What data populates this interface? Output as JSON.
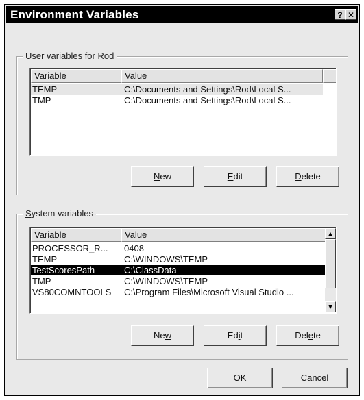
{
  "title": "Environment Variables",
  "titlebar_buttons": {
    "help": "?",
    "close": "✕"
  },
  "user_group": {
    "legend_first": "U",
    "legend_rest": "ser variables for Rod",
    "columns": [
      "Variable",
      "Value"
    ],
    "rows": [
      {
        "variable": "TEMP",
        "value": "C:\\Documents and Settings\\Rod\\Local S..."
      },
      {
        "variable": "TMP",
        "value": "C:\\Documents and Settings\\Rod\\Local S..."
      }
    ],
    "buttons": {
      "new_first": "N",
      "new_rest": "ew",
      "edit_first": "E",
      "edit_rest": "dit",
      "delete_first": "D",
      "delete_rest": "elete"
    }
  },
  "system_group": {
    "legend_first": "S",
    "legend_rest": "ystem variables",
    "columns": [
      "Variable",
      "Value"
    ],
    "rows": [
      {
        "variable": "PROCESSOR_R...",
        "value": "0408"
      },
      {
        "variable": "TEMP",
        "value": "C:\\WINDOWS\\TEMP"
      },
      {
        "variable": "TestScoresPath",
        "value": "C:\\ClassData"
      },
      {
        "variable": "TMP",
        "value": "C:\\WINDOWS\\TEMP"
      },
      {
        "variable": "VS80COMNTOOLS",
        "value": "C:\\Program Files\\Microsoft Visual Studio ..."
      }
    ],
    "buttons": {
      "new_pre": "Ne",
      "new_key": "w",
      "new_post": "",
      "edit_pre": "Ed",
      "edit_key": "i",
      "edit_post": "t",
      "delete_pre": "Del",
      "delete_key": "e",
      "delete_post": "te"
    }
  },
  "footer": {
    "ok": "OK",
    "cancel": "Cancel"
  }
}
